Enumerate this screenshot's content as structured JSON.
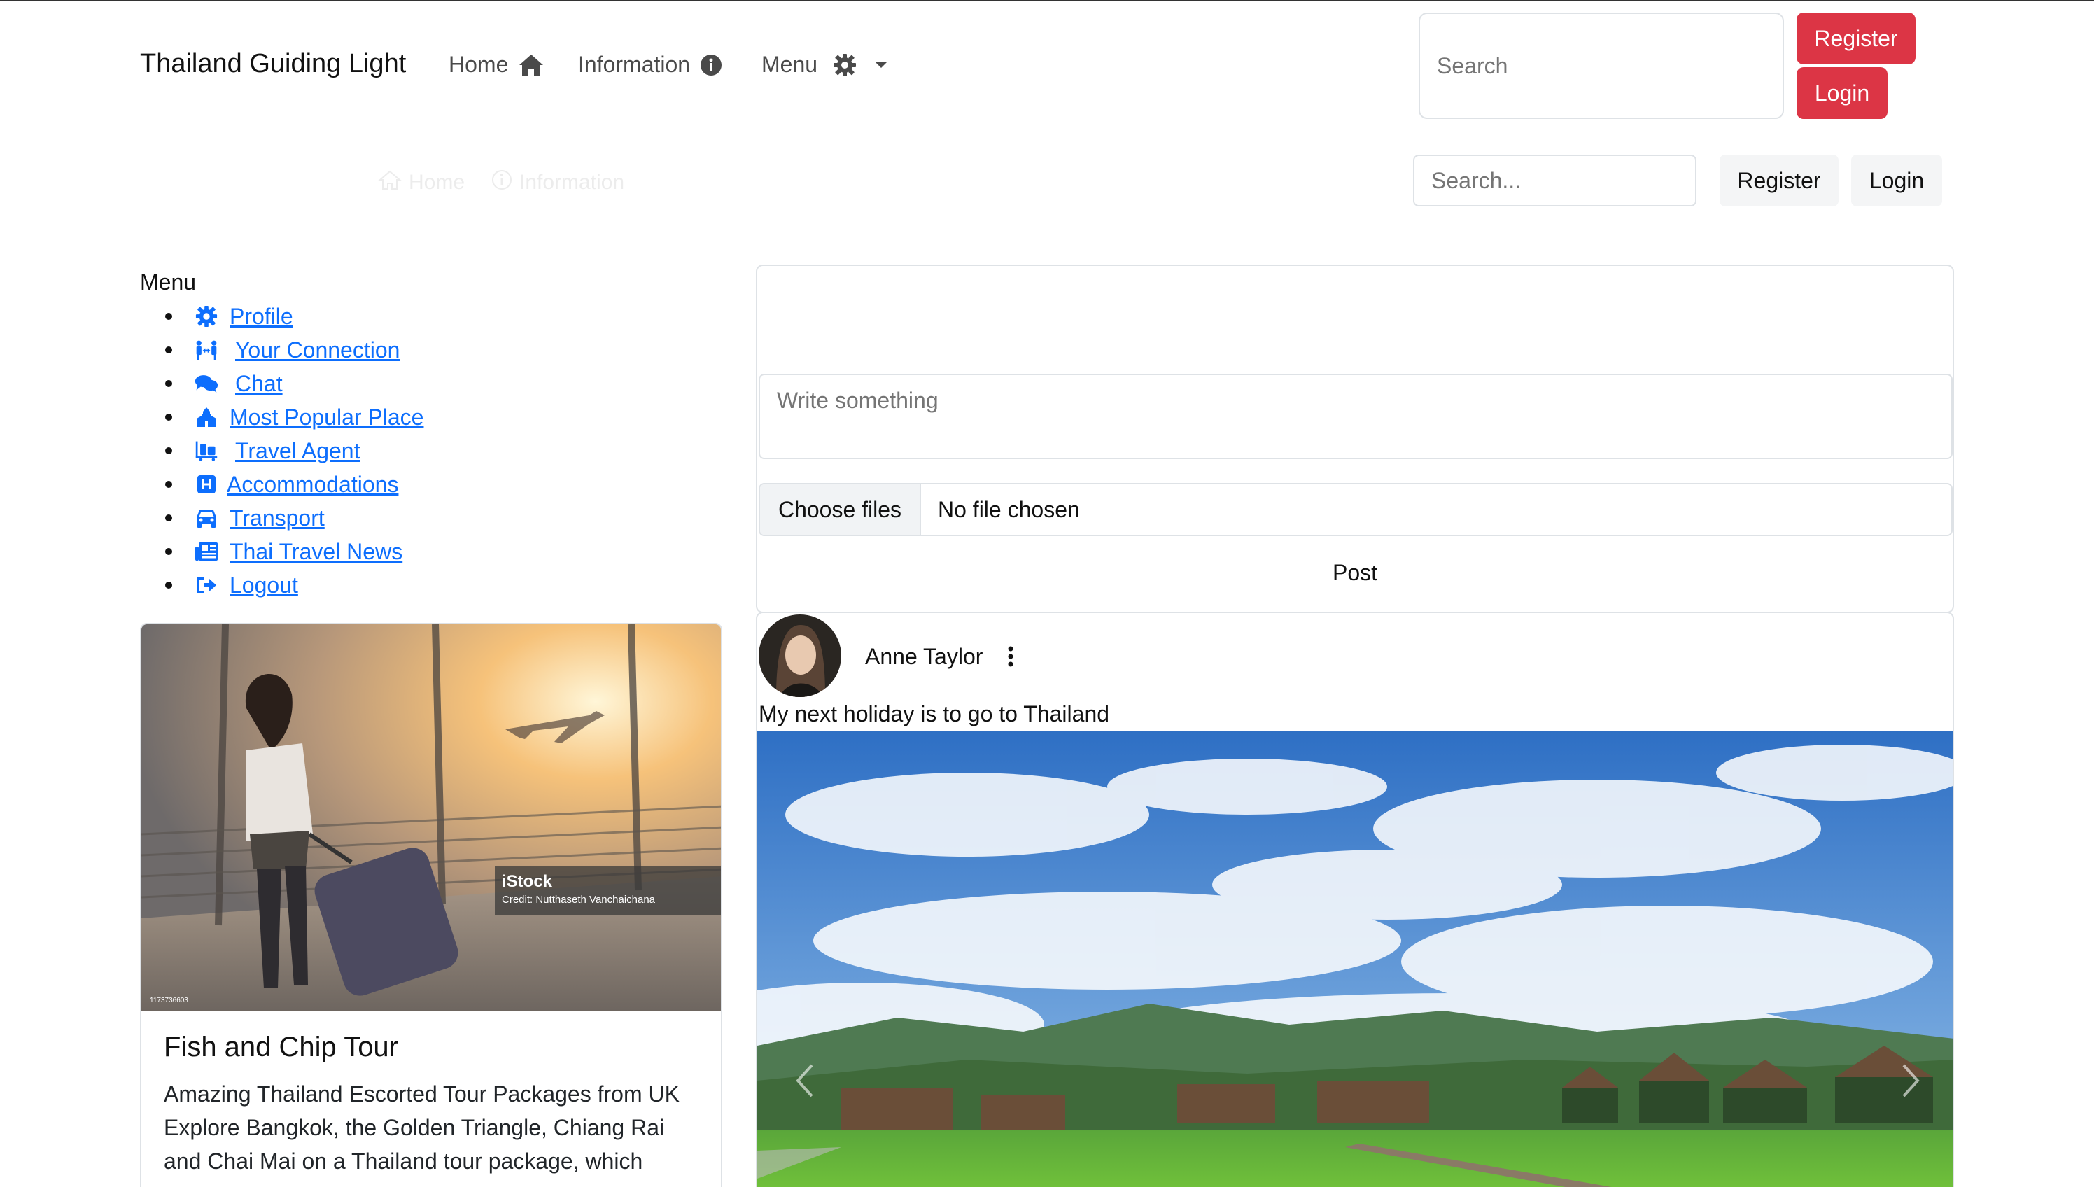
{
  "navbar": {
    "brand": "Thailand Guiding Light",
    "home_label": "Home",
    "information_label": "Information",
    "menu_label": "Menu",
    "search_placeholder": "Search",
    "register_label": "Register",
    "login_label": "Login"
  },
  "faded_nav": {
    "home_label": "Home",
    "information_label": "Information"
  },
  "secondary_bar": {
    "search_placeholder": "Search...",
    "register_label": "Register",
    "login_label": "Login"
  },
  "sidebar": {
    "title": "Menu",
    "items": [
      {
        "label": "Profile",
        "icon": "gear-icon"
      },
      {
        "label": "Your Connection",
        "icon": "people-arrows-icon"
      },
      {
        "label": "Chat",
        "icon": "comments-icon"
      },
      {
        "label": "Most Popular Place",
        "icon": "place-of-worship-icon"
      },
      {
        "label": "Travel Agent",
        "icon": "luggage-cart-icon"
      },
      {
        "label": "Accommodations",
        "icon": "hotel-icon"
      },
      {
        "label": "Transport",
        "icon": "car-icon"
      },
      {
        "label": "Thai Travel News",
        "icon": "newspaper-icon"
      },
      {
        "label": "Logout",
        "icon": "sign-out-icon"
      }
    ]
  },
  "tour_card": {
    "image_watermark": "iStock",
    "image_credit": "Credit: Nutthaseth Vanchaichana",
    "image_id": "1173736603",
    "title": "Fish and Chip Tour",
    "text": "Amazing Thailand Escorted Tour Packages from UK Explore Bangkok, the Golden Triangle, Chiang Rai and Chai Mai on a Thailand tour package, which"
  },
  "composer": {
    "placeholder": "Write something",
    "choose_files_label": "Choose files",
    "file_status": "No file chosen",
    "post_label": "Post"
  },
  "feed_post": {
    "author": "Anne Taylor",
    "text": "My next holiday is to go to Thailand"
  },
  "colors": {
    "link": "#0d6efd",
    "danger": "#dc3545",
    "border": "#dee2e6"
  }
}
